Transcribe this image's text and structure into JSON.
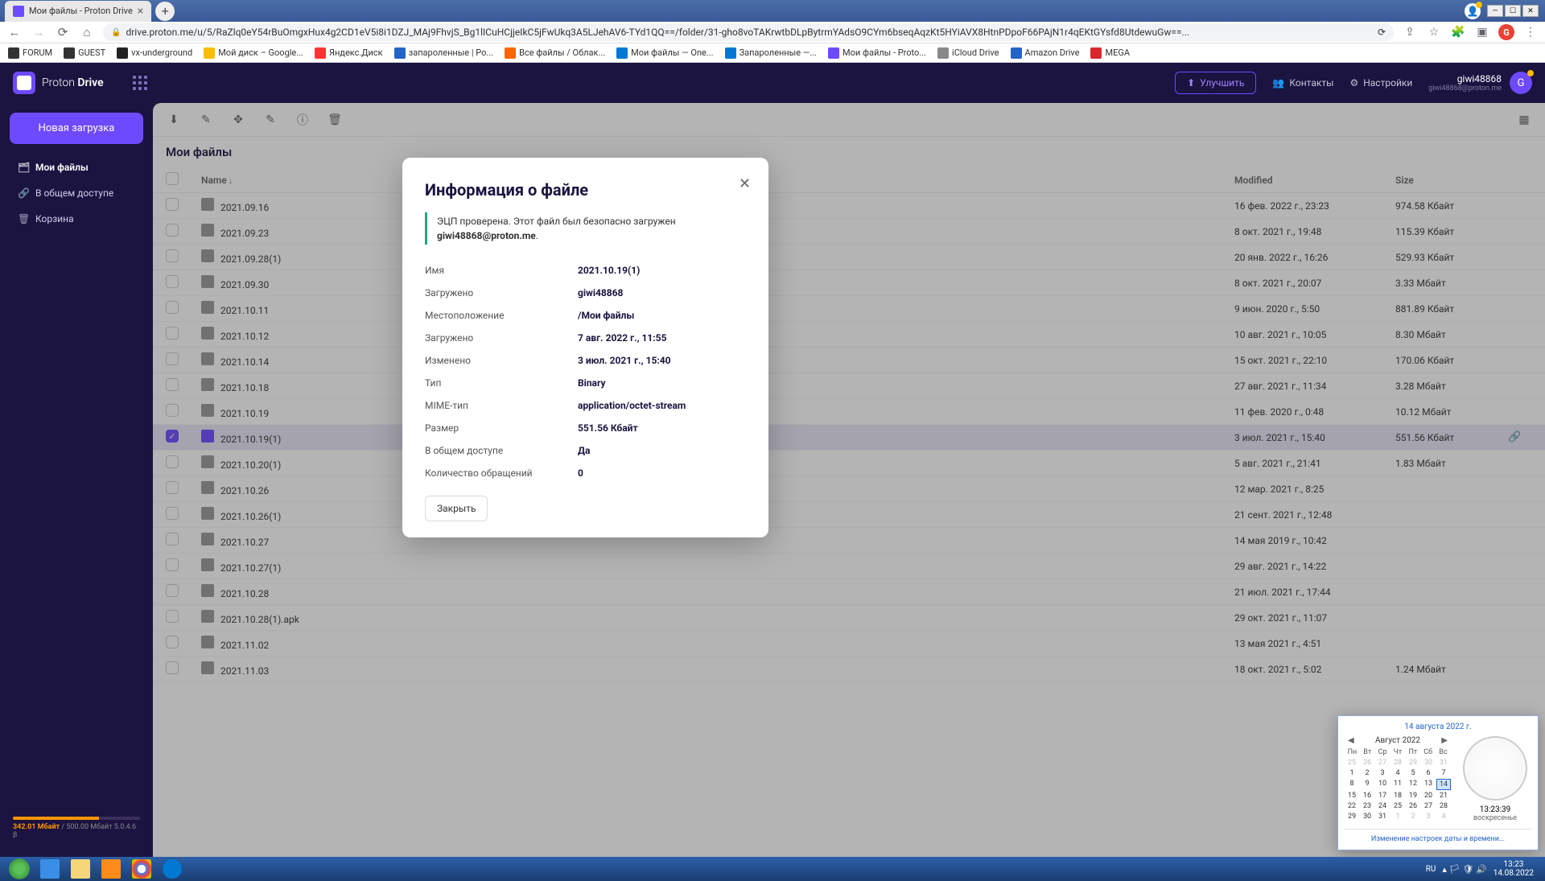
{
  "browser": {
    "tab_title": "Мои файлы - Proton Drive",
    "url": "drive.proton.me/u/5/RaZlq0eY54rBuOmgxHux4g2CD1eV5i8i1DZJ_MAj9FhvjS_Bg1lICuHCjjeIkC5jFwUkq3A5LJehAV6-TYd1QQ==/folder/31-gho8voTAKrwtbDLpBytrmYAdsO9CYm6bseqAqzKt5HYiAVX8HtnPDpoF66PAjN1r4qEKtGYsfd8UtdewuGw==...",
    "profile_initial": "G"
  },
  "bookmarks": [
    {
      "label": "FORUM",
      "color": "#333"
    },
    {
      "label": "GUEST",
      "color": "#333"
    },
    {
      "label": "vx-underground",
      "color": "#222"
    },
    {
      "label": "Мой диск – Google...",
      "color": "#fbbc04"
    },
    {
      "label": "Яндекс.Диск",
      "color": "#ff3333"
    },
    {
      "label": "запароленные | Ро...",
      "color": "#2264c8"
    },
    {
      "label": "Все файлы / Облак...",
      "color": "#ff6600"
    },
    {
      "label": "Мои файлы — One...",
      "color": "#0078d4"
    },
    {
      "label": "Запароленные —...",
      "color": "#0078d4"
    },
    {
      "label": "Мои файлы - Proto...",
      "color": "#6d4aff"
    },
    {
      "label": "iCloud Drive",
      "color": "#888"
    },
    {
      "label": "Amazon Drive",
      "color": "#2264c8"
    },
    {
      "label": "MEGA",
      "color": "#d9272e"
    }
  ],
  "header": {
    "logo": "Proton Drive",
    "upgrade": "Улучшить",
    "contacts": "Контакты",
    "settings": "Настройки",
    "user_name": "giwi48868",
    "user_email": "giwi48868@proton.me",
    "user_initial": "G"
  },
  "sidebar": {
    "upload": "Новая загрузка",
    "items": [
      {
        "label": "Мои файлы",
        "active": true
      },
      {
        "label": "В общем доступе",
        "active": false
      },
      {
        "label": "Корзина",
        "active": false
      }
    ],
    "storage_used": "342.01 Мбайт",
    "storage_sep": " / ",
    "storage_total": "500.00 Мбайт",
    "storage_suffix": " 5.0.4.6 β"
  },
  "content": {
    "breadcrumb": "Мои файлы",
    "columns": {
      "name": "Name",
      "modified": "Modified",
      "size": "Size"
    }
  },
  "files": [
    {
      "name": "2021.09.16",
      "modified": "16 фев. 2022 г., 23:23",
      "size": "974.58 Кбайт"
    },
    {
      "name": "2021.09.23",
      "modified": "8 окт. 2021 г., 19:48",
      "size": "115.39 Кбайт"
    },
    {
      "name": "2021.09.28(1)",
      "modified": "20 янв. 2022 г., 16:26",
      "size": "529.93 Кбайт"
    },
    {
      "name": "2021.09.30",
      "modified": "8 окт. 2021 г., 20:07",
      "size": "3.33 Мбайт"
    },
    {
      "name": "2021.10.11",
      "modified": "9 июн. 2020 г., 5:50",
      "size": "881.89 Кбайт"
    },
    {
      "name": "2021.10.12",
      "modified": "10 авг. 2021 г., 10:05",
      "size": "8.30 Мбайт"
    },
    {
      "name": "2021.10.14",
      "modified": "15 окт. 2021 г., 22:10",
      "size": "170.06 Кбайт"
    },
    {
      "name": "2021.10.18",
      "modified": "27 авг. 2021 г., 11:34",
      "size": "3.28 Мбайт"
    },
    {
      "name": "2021.10.19",
      "modified": "11 фев. 2020 г., 0:48",
      "size": "10.12 Мбайт"
    },
    {
      "name": "2021.10.19(1)",
      "modified": "3 июл. 2021 г., 15:40",
      "size": "551.56 Кбайт",
      "selected": true,
      "shared": true
    },
    {
      "name": "2021.10.20(1)",
      "modified": "5 авг. 2021 г., 21:41",
      "size": "1.83 Мбайт"
    },
    {
      "name": "2021.10.26",
      "modified": "12 мар. 2021 г., 8:25",
      "size": ""
    },
    {
      "name": "2021.10.26(1)",
      "modified": "21 сент. 2021 г., 12:48",
      "size": ""
    },
    {
      "name": "2021.10.27",
      "modified": "14 мая 2019 г., 10:42",
      "size": ""
    },
    {
      "name": "2021.10.27(1)",
      "modified": "29 авг. 2021 г., 14:22",
      "size": ""
    },
    {
      "name": "2021.10.28",
      "modified": "21 июл. 2021 г., 17:44",
      "size": ""
    },
    {
      "name": "2021.10.28(1).apk",
      "modified": "29 окт. 2021 г., 11:07",
      "size": ""
    },
    {
      "name": "2021.11.02",
      "modified": "13 мая 2021 г., 4:51",
      "size": ""
    },
    {
      "name": "2021.11.03",
      "modified": "18 окт. 2021 г., 5:02",
      "size": "1.24 Мбайт"
    }
  ],
  "modal": {
    "title": "Информация о файле",
    "sig_prefix": "ЭЦП проверена. Этот файл был безопасно загружен ",
    "sig_user": "giwi48868@proton.me",
    "details": [
      {
        "label": "Имя",
        "value": "2021.10.19(1)"
      },
      {
        "label": "Загружено",
        "value": "giwi48868"
      },
      {
        "label": "Местоположение",
        "value": "/Мои файлы"
      },
      {
        "label": "Загружено",
        "value": "7 авг. 2022 г., 11:55"
      },
      {
        "label": "Изменено",
        "value": "3 июл. 2021 г., 15:40"
      },
      {
        "label": "Тип",
        "value": "Binary"
      },
      {
        "label": "MIME-тип",
        "value": "application/octet-stream"
      },
      {
        "label": "Размер",
        "value": "551.56 Кбайт"
      },
      {
        "label": "В общем доступе",
        "value": "Да"
      },
      {
        "label": "Количество обращений",
        "value": "0"
      }
    ],
    "close": "Закрыть"
  },
  "calendar": {
    "title": "14 августа 2022 г.",
    "month": "Август 2022",
    "dow": [
      "Пн",
      "Вт",
      "Ср",
      "Чт",
      "Пт",
      "Сб",
      "Вс"
    ],
    "time": "13:23:39",
    "dayname": "воскресенье",
    "link": "Изменение настроек даты и времени..."
  },
  "taskbar": {
    "lang": "RU",
    "time": "13:23",
    "date": "14.08.2022"
  }
}
